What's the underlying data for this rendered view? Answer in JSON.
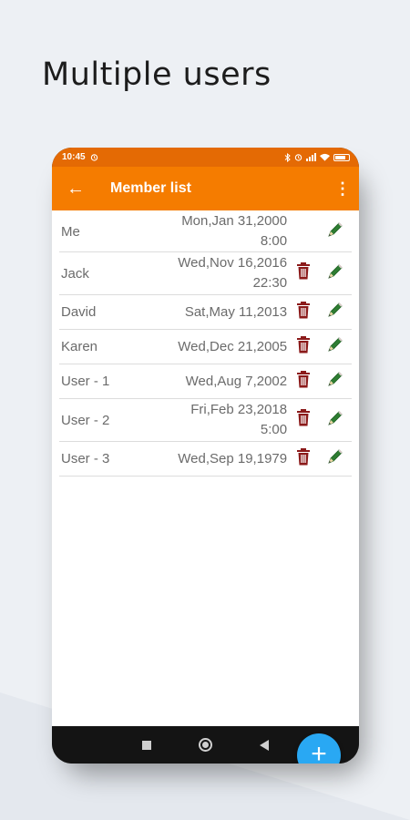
{
  "headline": "Multiple users",
  "status": {
    "time": "10:45",
    "alarm_icon": "alarm-icon",
    "right_icons": [
      "bluetooth-icon",
      "alarm-icon",
      "signal-icon",
      "wifi-icon",
      "battery-icon"
    ]
  },
  "appbar": {
    "title": "Member list",
    "back_icon": "←",
    "menu_icon": "⋮"
  },
  "members": [
    {
      "name": "Me",
      "date_line1": "Mon,Jan 31,2000",
      "date_line2": "8:00",
      "deletable": false
    },
    {
      "name": "Jack",
      "date_line1": "Wed,Nov 16,2016",
      "date_line2": "22:30",
      "deletable": true
    },
    {
      "name": "David",
      "date_line1": "Sat,May 11,2013",
      "date_line2": "",
      "deletable": true
    },
    {
      "name": "Karen",
      "date_line1": "Wed,Dec 21,2005",
      "date_line2": "",
      "deletable": true
    },
    {
      "name": "User - 1",
      "date_line1": "Wed,Aug 7,2002",
      "date_line2": "",
      "deletable": true
    },
    {
      "name": "User - 2",
      "date_line1": "Fri,Feb 23,2018",
      "date_line2": "5:00",
      "deletable": true
    },
    {
      "name": "User - 3",
      "date_line1": "Wed,Sep 19,1979",
      "date_line2": "",
      "deletable": true
    }
  ],
  "fab_label": "+",
  "colors": {
    "status_bar": "#e46a04",
    "app_bar": "#f57c00",
    "fab": "#29a8f3",
    "delete_icon": "#8b1a1a",
    "edit_icon": "#2e7d32"
  }
}
